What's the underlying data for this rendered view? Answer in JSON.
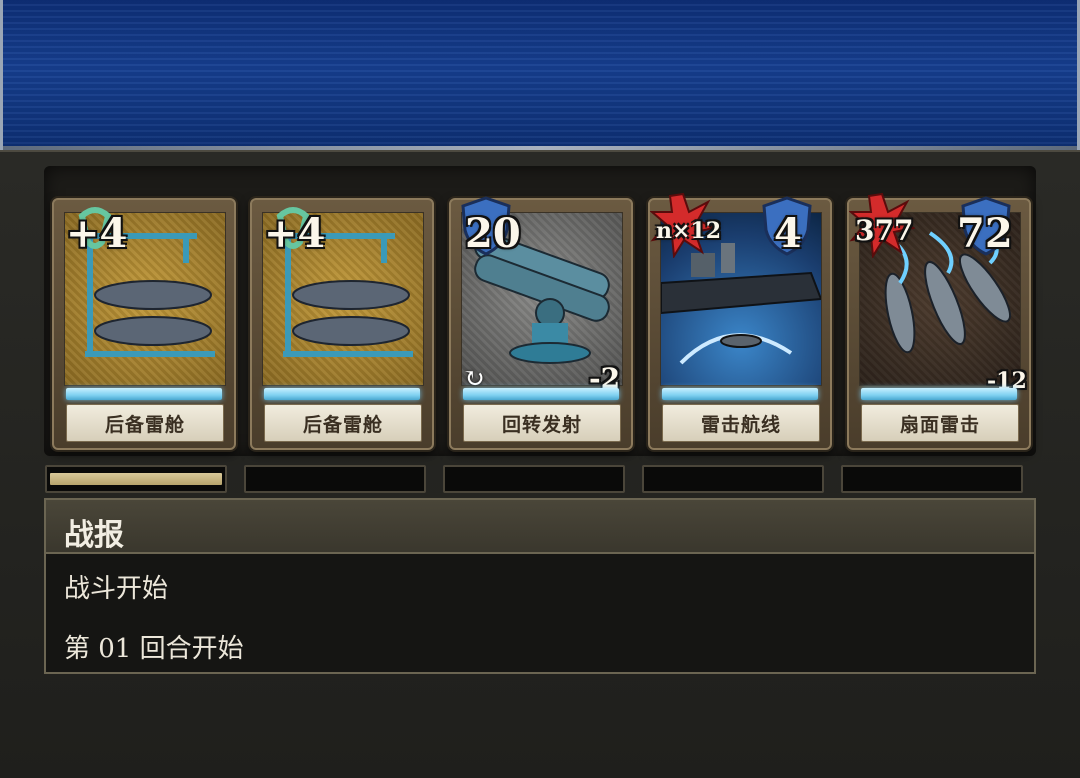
{
  "report": {
    "title": "战报",
    "lines": [
      "战斗开始",
      "第 01 回合开始"
    ]
  },
  "cards": [
    {
      "name": "后备雷舱",
      "top_left": "+4",
      "art": "torpedo-rack",
      "theme": "#c39a3a"
    },
    {
      "name": "后备雷舱",
      "top_left": "+4",
      "art": "torpedo-rack",
      "theme": "#c39a3a"
    },
    {
      "name": "回转发射",
      "top_left": "20",
      "bottom_right": "-2",
      "art": "rotating-launcher",
      "theme": "#8a8a88"
    },
    {
      "name": "雷击航线",
      "top_left": "n×12",
      "top_right": "4",
      "art": "torpedo-wake-ship",
      "theme": "#3b86c9"
    },
    {
      "name": "扇面雷击",
      "top_left": "377",
      "top_right": "72",
      "bottom_right": "-12",
      "art": "torpedo-fan",
      "theme": "#4c3b2d"
    }
  ],
  "slots": [
    {
      "fill": 1.0
    },
    {
      "fill": 0.0
    },
    {
      "fill": 0.0
    },
    {
      "fill": 0.0
    },
    {
      "fill": 0.0
    }
  ],
  "colors": {
    "shield": "#3b6fc0",
    "burst": "#d42b2b",
    "energy": "#7fd1f0",
    "plate": "#e6dfcb"
  },
  "icons": [
    "shield-icon",
    "attack-burst-icon",
    "cycle-icon",
    "clip-icon"
  ]
}
